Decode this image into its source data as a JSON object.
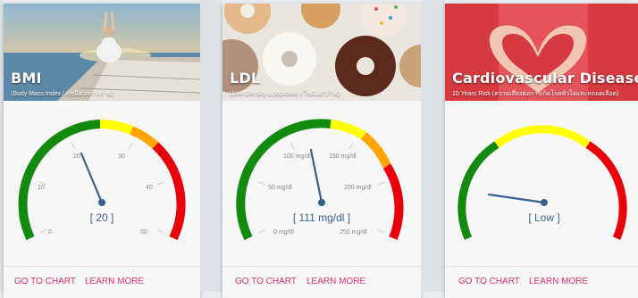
{
  "cards": [
    {
      "title": "BMI",
      "subtitle": "(Body Mass Index / ดัชนีมวลร่างกาย)",
      "photo": "yoga-on-pier-at-sunset",
      "readout": "[ 20 ]",
      "ticks": [
        "0",
        "10",
        "20",
        "30",
        "40",
        "50"
      ],
      "value": 20,
      "actions": {
        "chart": "GO TO CHART",
        "learn": "LEARN MORE"
      }
    },
    {
      "title": "LDL",
      "subtitle": "(Low-Density Lipoprotein / ไขมันตัวร้าย)",
      "photo": "donuts",
      "readout": "[ 111 mg/dl ]",
      "ticks": [
        "0 mg/dl",
        "50 mg/dl",
        "100 mg/dl",
        "150 mg/dl",
        "200 mg/dl",
        "250 mg/dl"
      ],
      "value": 111,
      "actions": {
        "chart": "GO TO CHART",
        "learn": "LEARN MORE"
      }
    },
    {
      "title": "Cardiovascular Disease",
      "subtitle": "10 Years Risk (ความเสี่ยงต่อการเกิดโรคหัวใจและหลอดเลือด)",
      "photo": "hands-making-heart",
      "readout": "[ Low ]",
      "ticks": [],
      "value": "Low",
      "actions": {
        "chart": "GO TO CHART",
        "learn": "LEARN MORE"
      }
    }
  ],
  "colors": {
    "green": "#138a0e",
    "yellow": "#ffff00",
    "orange": "#ffa500",
    "red": "#e8000b",
    "needle": "#3a5f8f",
    "accent": "#e5306a"
  }
}
